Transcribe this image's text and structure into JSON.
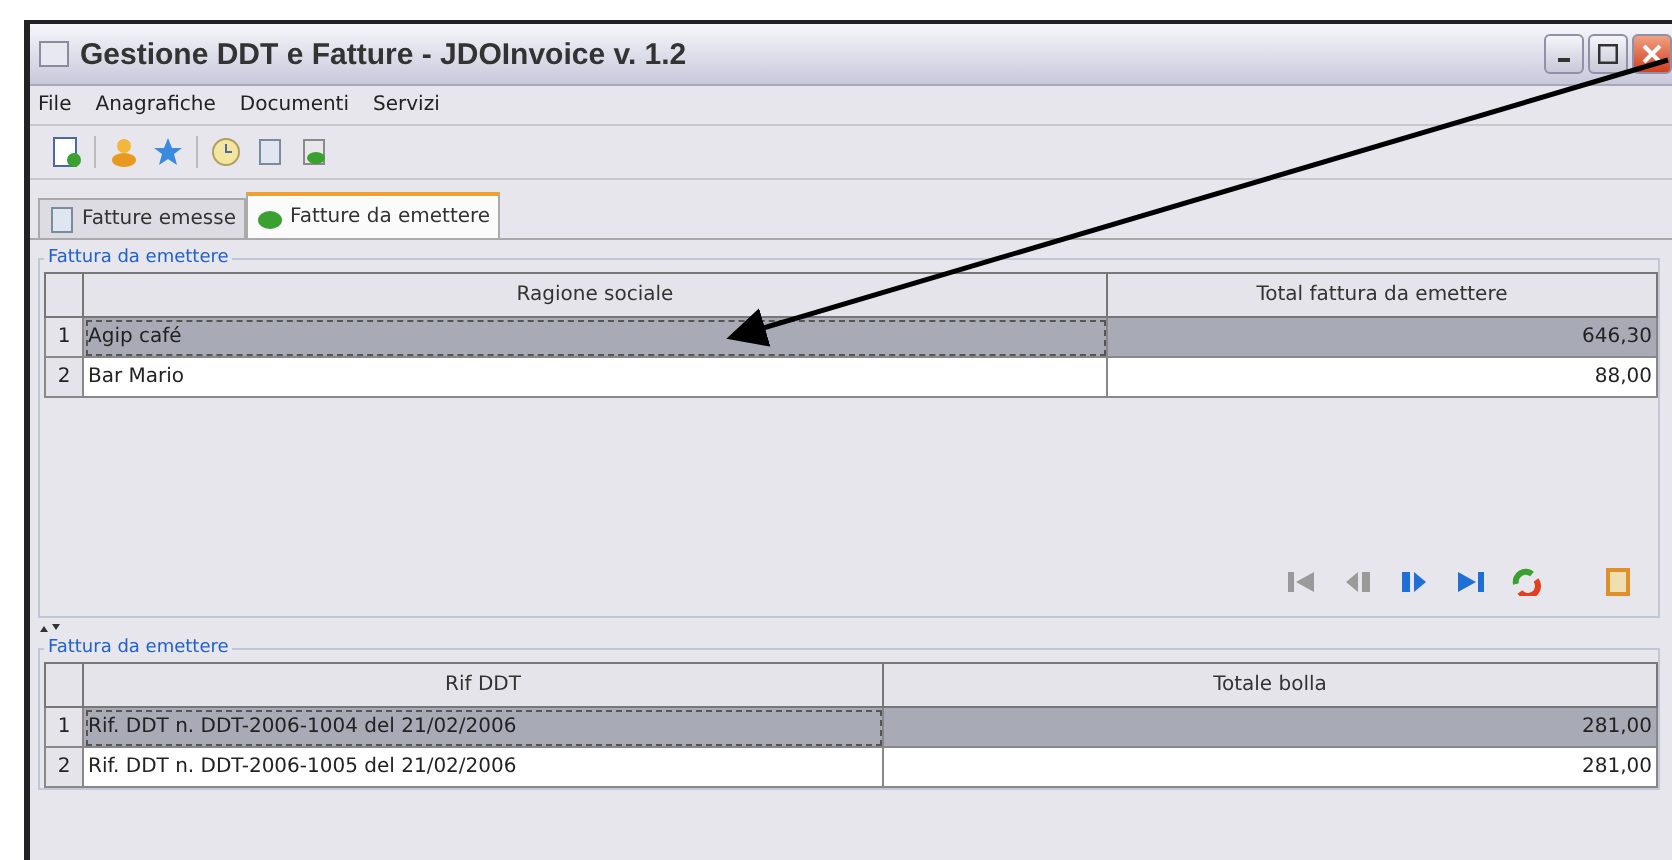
{
  "window": {
    "title": "Gestione DDT e Fatture - JDOInvoice v. 1.2"
  },
  "menu": [
    "File",
    "Anagrafiche",
    "Documenti",
    "Servizi"
  ],
  "tabs": [
    {
      "label": "Fatture emesse",
      "selected": false
    },
    {
      "label": "Fatture da emettere",
      "selected": true
    }
  ],
  "invoices_panel": {
    "title": "Fattura da emettere",
    "columns": [
      "Ragione sociale",
      "Total fattura da emettere"
    ],
    "rows": [
      {
        "number": "1",
        "cells": [
          "Agip café",
          "646,30"
        ],
        "selected": true
      },
      {
        "number": "2",
        "cells": [
          "Bar Mario",
          "88,00"
        ],
        "selected": false
      }
    ]
  },
  "nav_buttons": [
    {
      "kind": "first",
      "disabled": true
    },
    {
      "kind": "previous",
      "disabled": true
    },
    {
      "kind": "next",
      "disabled": false
    },
    {
      "kind": "last",
      "disabled": false
    },
    {
      "kind": "refresh",
      "disabled": false
    },
    {
      "kind": "open",
      "disabled": false
    }
  ],
  "ddt_panel": {
    "title": "Fattura da emettere",
    "columns": [
      "Rif DDT",
      "Totale bolla"
    ],
    "rows": [
      {
        "number": "1",
        "cells": [
          "Rif. DDT n. DDT-2006-1004 del 21/02/2006",
          "281,00"
        ],
        "selected": true
      },
      {
        "number": "2",
        "cells": [
          "Rif. DDT n. DDT-2006-1005 del 21/02/2006",
          "281,00"
        ],
        "selected": false
      }
    ]
  }
}
